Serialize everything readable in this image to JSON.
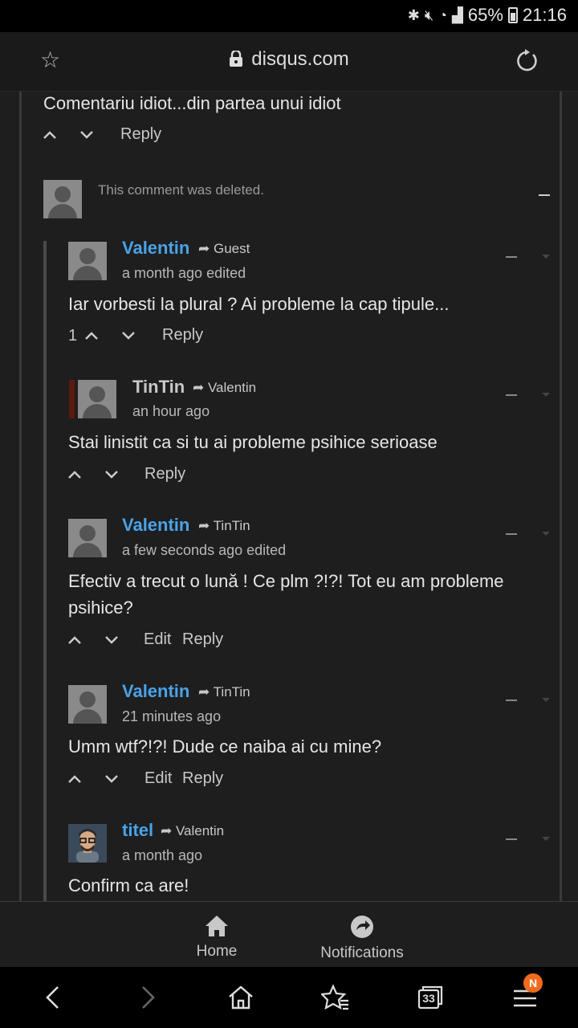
{
  "status_bar": {
    "battery": "65%",
    "time": "21:16"
  },
  "browser": {
    "url": "disqus.com"
  },
  "comments": {
    "top_text": "Comentariu idiot...din partea unui idiot",
    "top_reply": "Reply",
    "deleted_text": "This comment was deleted.",
    "c1": {
      "author": "Valentin",
      "to": "Guest",
      "meta": "a month ago edited",
      "text": "Iar vorbesti la plural ? Ai probleme la cap tipule...",
      "count": "1",
      "reply": "Reply"
    },
    "c2": {
      "author": "TinTin",
      "to": "Valentin",
      "meta": "an hour ago",
      "text": "Stai linistit ca si tu ai probleme psihice serioase",
      "reply": "Reply"
    },
    "c3": {
      "author": "Valentin",
      "to": "TinTin",
      "meta": "a few seconds ago edited",
      "text_line1": "Efectiv a trecut o lună ! Ce plm ?!?! Tot eu am probleme",
      "text_line2": "psihice?",
      "edit": "Edit",
      "reply": "Reply"
    },
    "c4": {
      "author": "Valentin",
      "to": "TinTin",
      "meta": "21 minutes ago",
      "text": "Umm wtf?!?! Dude ce naiba ai cu mine?",
      "edit": "Edit",
      "reply": "Reply"
    },
    "c5": {
      "author": "titel",
      "to": "Valentin",
      "meta": "a month ago",
      "text": "Confirm ca are!"
    }
  },
  "app_nav": {
    "home": "Home",
    "notifications": "Notifications"
  },
  "browser_nav": {
    "tabs_count": "33",
    "menu_badge": "N"
  },
  "colors": {
    "accent": "#4aa3e8",
    "badge": "#f26b1d"
  }
}
